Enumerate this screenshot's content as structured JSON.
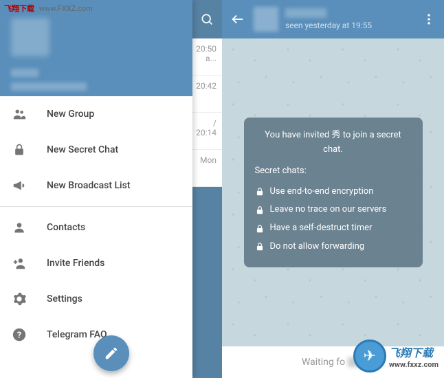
{
  "watermark": {
    "top_cn": "飞翔下载",
    "top_url": "www.FXXZ.com",
    "bottom_cn": "飞翔下载",
    "bottom_url": "www.fxxz.com"
  },
  "drawer": {
    "items": [
      {
        "icon": "group",
        "label": "New Group"
      },
      {
        "icon": "lock",
        "label": "New Secret Chat"
      },
      {
        "icon": "megaphone",
        "label": "New Broadcast List"
      }
    ],
    "items2": [
      {
        "icon": "person",
        "label": "Contacts"
      },
      {
        "icon": "person-add",
        "label": "Invite Friends"
      },
      {
        "icon": "gear",
        "label": "Settings"
      },
      {
        "icon": "help",
        "label": "Telegram FAQ"
      }
    ]
  },
  "chatlist": {
    "rows": [
      {
        "time": "20:50",
        "preview": "a..."
      },
      {
        "time": "20:42",
        "preview": ""
      },
      {
        "time": "20:14",
        "preview": ""
      },
      {
        "time": "Mon",
        "preview": ""
      }
    ]
  },
  "chat": {
    "status_prefix": "seen yesterday at",
    "status_time": "19:55",
    "info_intro_a": "You have invited",
    "info_intro_name": "秀",
    "info_intro_b": "to join a secret chat.",
    "subtitle": "Secret chats:",
    "features": [
      "Use end-to-end encryption",
      "Leave no trace on our servers",
      "Have a self-destruct timer",
      "Do not allow forwarding"
    ],
    "input_waiting": "Waiting fo"
  }
}
